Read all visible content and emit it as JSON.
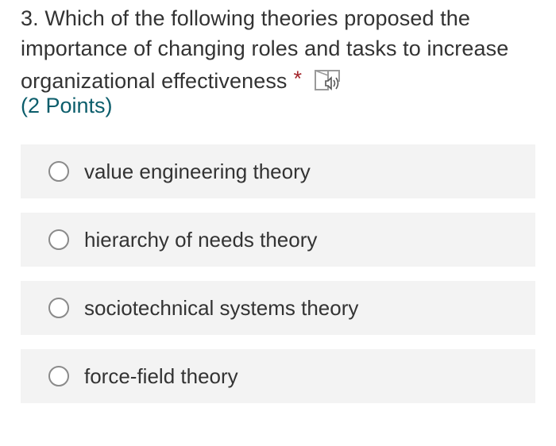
{
  "question": {
    "number": "3.",
    "text": "Which of the following theories proposed the importance of changing roles and tasks to increase organizational effectiveness",
    "required_marker": "*",
    "immersive_reader_icon": "immersive-reader-speaker-icon",
    "points": "(2 Points)"
  },
  "options": [
    {
      "label": "value engineering theory",
      "selected": false
    },
    {
      "label": "hierarchy of needs theory",
      "selected": false
    },
    {
      "label": "sociotechnical systems theory",
      "selected": false
    },
    {
      "label": "force-field theory",
      "selected": false
    }
  ],
  "colors": {
    "text": "#333333",
    "required": "#a4262c",
    "points": "#0b5d6b",
    "option_background": "#f3f3f3",
    "radio_border": "#8a8a8a"
  }
}
